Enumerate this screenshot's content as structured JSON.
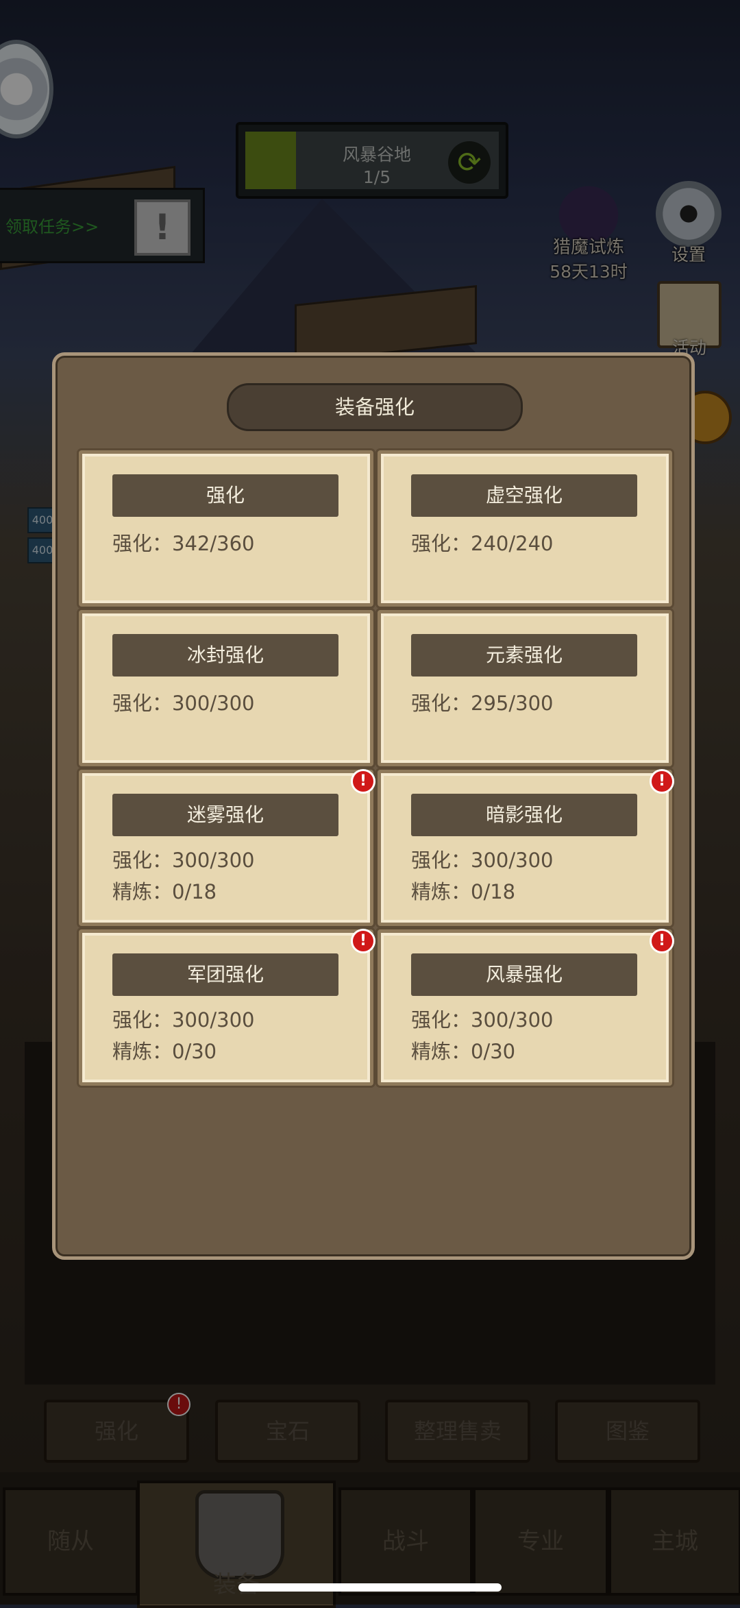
{
  "hud": {
    "stage_name": "风暴谷地",
    "stage_progress": "1/5",
    "quest_label": "领取任务>>",
    "hunt_label": "猎魔试炼",
    "hunt_time": "58天13时",
    "settings_label": "设置",
    "event_label": "活动",
    "side_values": [
      "400",
      "400"
    ]
  },
  "dialog": {
    "title": "装备强化",
    "cards": [
      {
        "title": "强化",
        "lines": [
          "强化：342/360"
        ],
        "alert": false
      },
      {
        "title": "虚空强化",
        "lines": [
          "强化：240/240"
        ],
        "alert": false
      },
      {
        "title": "冰封强化",
        "lines": [
          "强化：300/300"
        ],
        "alert": false
      },
      {
        "title": "元素强化",
        "lines": [
          "强化：295/300"
        ],
        "alert": false
      },
      {
        "title": "迷雾强化",
        "lines": [
          "强化：300/300",
          "精炼：0/18"
        ],
        "alert": true
      },
      {
        "title": "暗影强化",
        "lines": [
          "强化：300/300",
          "精炼：0/18"
        ],
        "alert": true
      },
      {
        "title": "军团强化",
        "lines": [
          "强化：300/300",
          "精炼：0/30"
        ],
        "alert": true
      },
      {
        "title": "风暴强化",
        "lines": [
          "强化：300/300",
          "精炼：0/30"
        ],
        "alert": true
      }
    ],
    "alert_glyph": "!"
  },
  "sub_tabs": [
    "强化",
    "宝石",
    "整理售卖",
    "图鉴"
  ],
  "nav": [
    "随从",
    "装备",
    "战斗",
    "专业",
    "主城"
  ],
  "colors": {
    "alert": "#d01818",
    "card_bg": "#e7d7b1",
    "dialog_bg": "#6b5a45"
  }
}
